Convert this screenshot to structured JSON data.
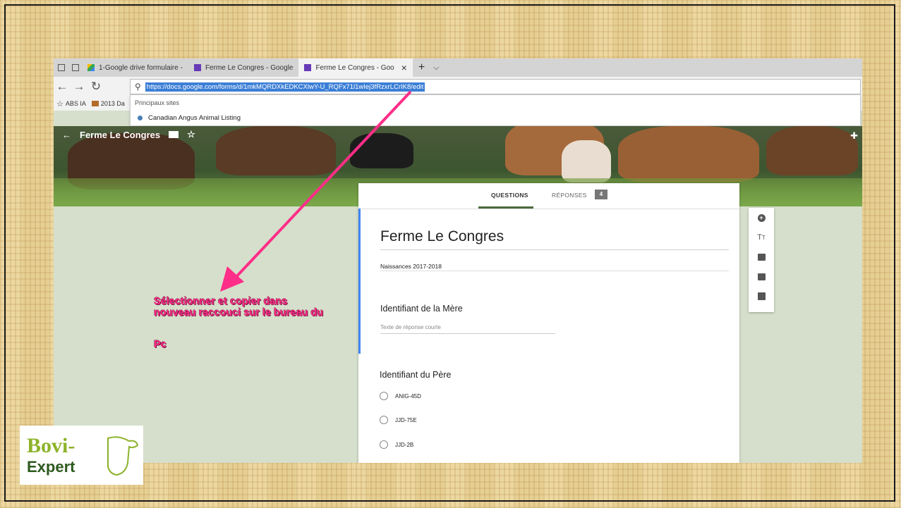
{
  "browser": {
    "tabs": [
      {
        "label": "1-Google drive formulaire -",
        "icon": "google-drive-icon"
      },
      {
        "label": "Ferme Le Congres - Google",
        "icon": "google-forms-icon"
      },
      {
        "label": "Ferme Le Congres - Goo",
        "icon": "google-forms-icon",
        "active": true
      }
    ],
    "url": "https://docs.google.com/forms/d/1mkMQRDXkEDKCXlwY-U_RQFx71l1wIej3fRzxrLCrIK8/edit",
    "favorites": [
      {
        "label": "ABS IA"
      },
      {
        "label": "2013 Da"
      }
    ],
    "dropdown": {
      "header": "Principaux sites",
      "item": "Canadian Angus Animal Listing"
    }
  },
  "app": {
    "title": "Ferme Le Congres",
    "tabs": {
      "questions": "QUESTIONS",
      "responses": "RÉPONSES",
      "response_count": "4"
    },
    "form_title": "Ferme  Le Congres",
    "form_description": "Naissances 2017-2018",
    "questions": [
      {
        "label": "Identifiant de la Mère",
        "placeholder": "Texte de réponse courte"
      },
      {
        "label": "Identifiant du Père",
        "options": [
          "ANIG-45D",
          "JJD-75E",
          "JJD-2B"
        ]
      }
    ]
  },
  "annotation": {
    "line1": "Sélectionner et copier dans",
    "line2": "nouveau raccouci sur le bureau du",
    "line3": "Pc",
    "color": "#ff2e88"
  },
  "logo": {
    "line1": "Bovi-",
    "line2": "Expert"
  }
}
